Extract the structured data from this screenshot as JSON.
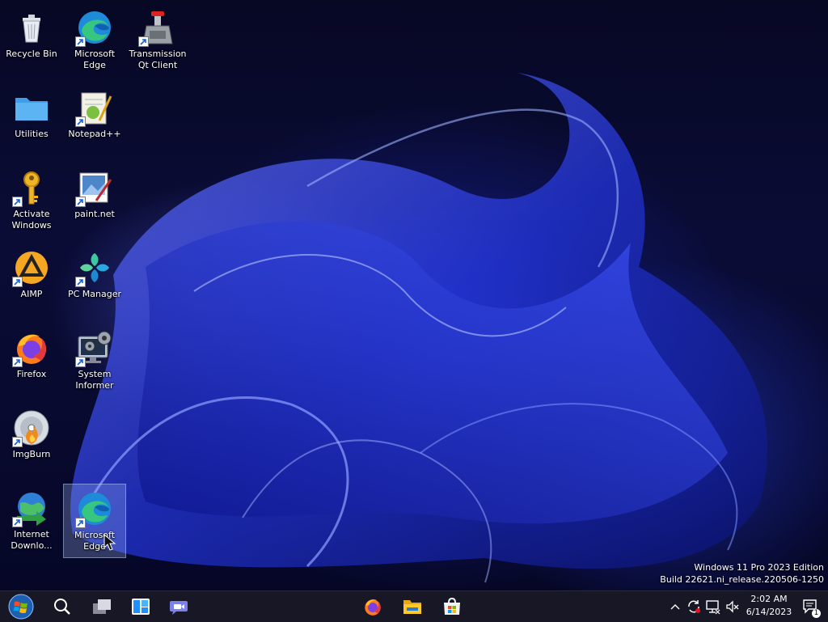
{
  "desktop": {
    "icons": [
      {
        "label": "Recycle Bin",
        "icon": "recycle-bin-icon"
      },
      {
        "label": "Microsoft\nEdge",
        "icon": "edge-icon"
      },
      {
        "label": "Transmission\nQt Client",
        "icon": "transmission-icon"
      },
      {
        "label": "Utilities",
        "icon": "folder-icon"
      },
      {
        "label": "Notepad++",
        "icon": "notepadpp-icon"
      },
      {
        "label": "Activate\nWindows",
        "icon": "key-icon"
      },
      {
        "label": "paint.net",
        "icon": "paintnet-icon"
      },
      {
        "label": "AIMP",
        "icon": "aimp-icon"
      },
      {
        "label": "PC Manager",
        "icon": "pc-manager-icon"
      },
      {
        "label": "Firefox",
        "icon": "firefox-icon"
      },
      {
        "label": "System\nInformer",
        "icon": "system-informer-icon"
      },
      {
        "label": "ImgBurn",
        "icon": "imgburn-icon"
      },
      {
        "label": "Internet\nDownlo...",
        "icon": "internet-download-manager-icon"
      },
      {
        "label": "Microsoft\nEdge",
        "icon": "edge-icon",
        "selected": true
      }
    ]
  },
  "watermark": {
    "line1": "Windows 11 Pro 2023 Edition",
    "line2": "Build 22621.ni_release.220506-1250"
  },
  "taskbar": {
    "left_buttons": [
      "start-orb-icon",
      "search-icon",
      "task-view-icon",
      "widgets-icon",
      "teams-chat-icon"
    ],
    "pinned": [
      "firefox-icon",
      "file-explorer-icon",
      "microsoft-store-icon"
    ],
    "tray": [
      "chevron-up-icon",
      "sync-icon",
      "network-icon",
      "volume-muted-icon"
    ],
    "time": "2:02 AM",
    "date": "6/14/2023",
    "notification_count": "1"
  },
  "colors": {
    "accent": "#2b4bff",
    "taskbar_bg": "#19192a"
  }
}
